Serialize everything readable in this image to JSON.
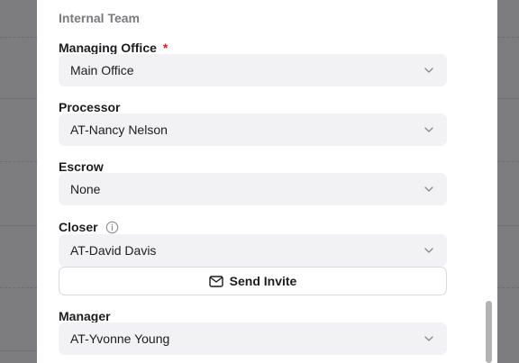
{
  "section": {
    "title": "Internal Team"
  },
  "fields": [
    {
      "label": "Managing Office",
      "required_mark": "*",
      "value": "Main Office"
    },
    {
      "label": "Processor",
      "value": "AT-Nancy Nelson"
    },
    {
      "label": "Escrow",
      "value": "None"
    },
    {
      "label": "Closer",
      "value": "AT-David Davis"
    },
    {
      "label": "Manager",
      "value": "AT-Yvonne Young"
    }
  ],
  "invite": {
    "label": "Send Invite"
  },
  "icons": {
    "chevron": "chevron-down-icon",
    "info": "info-icon",
    "mail": "mail-icon"
  },
  "colors": {
    "required": "#dd2222",
    "field_bg": "#f2f2f4",
    "overlay": "#7d7d7f"
  }
}
